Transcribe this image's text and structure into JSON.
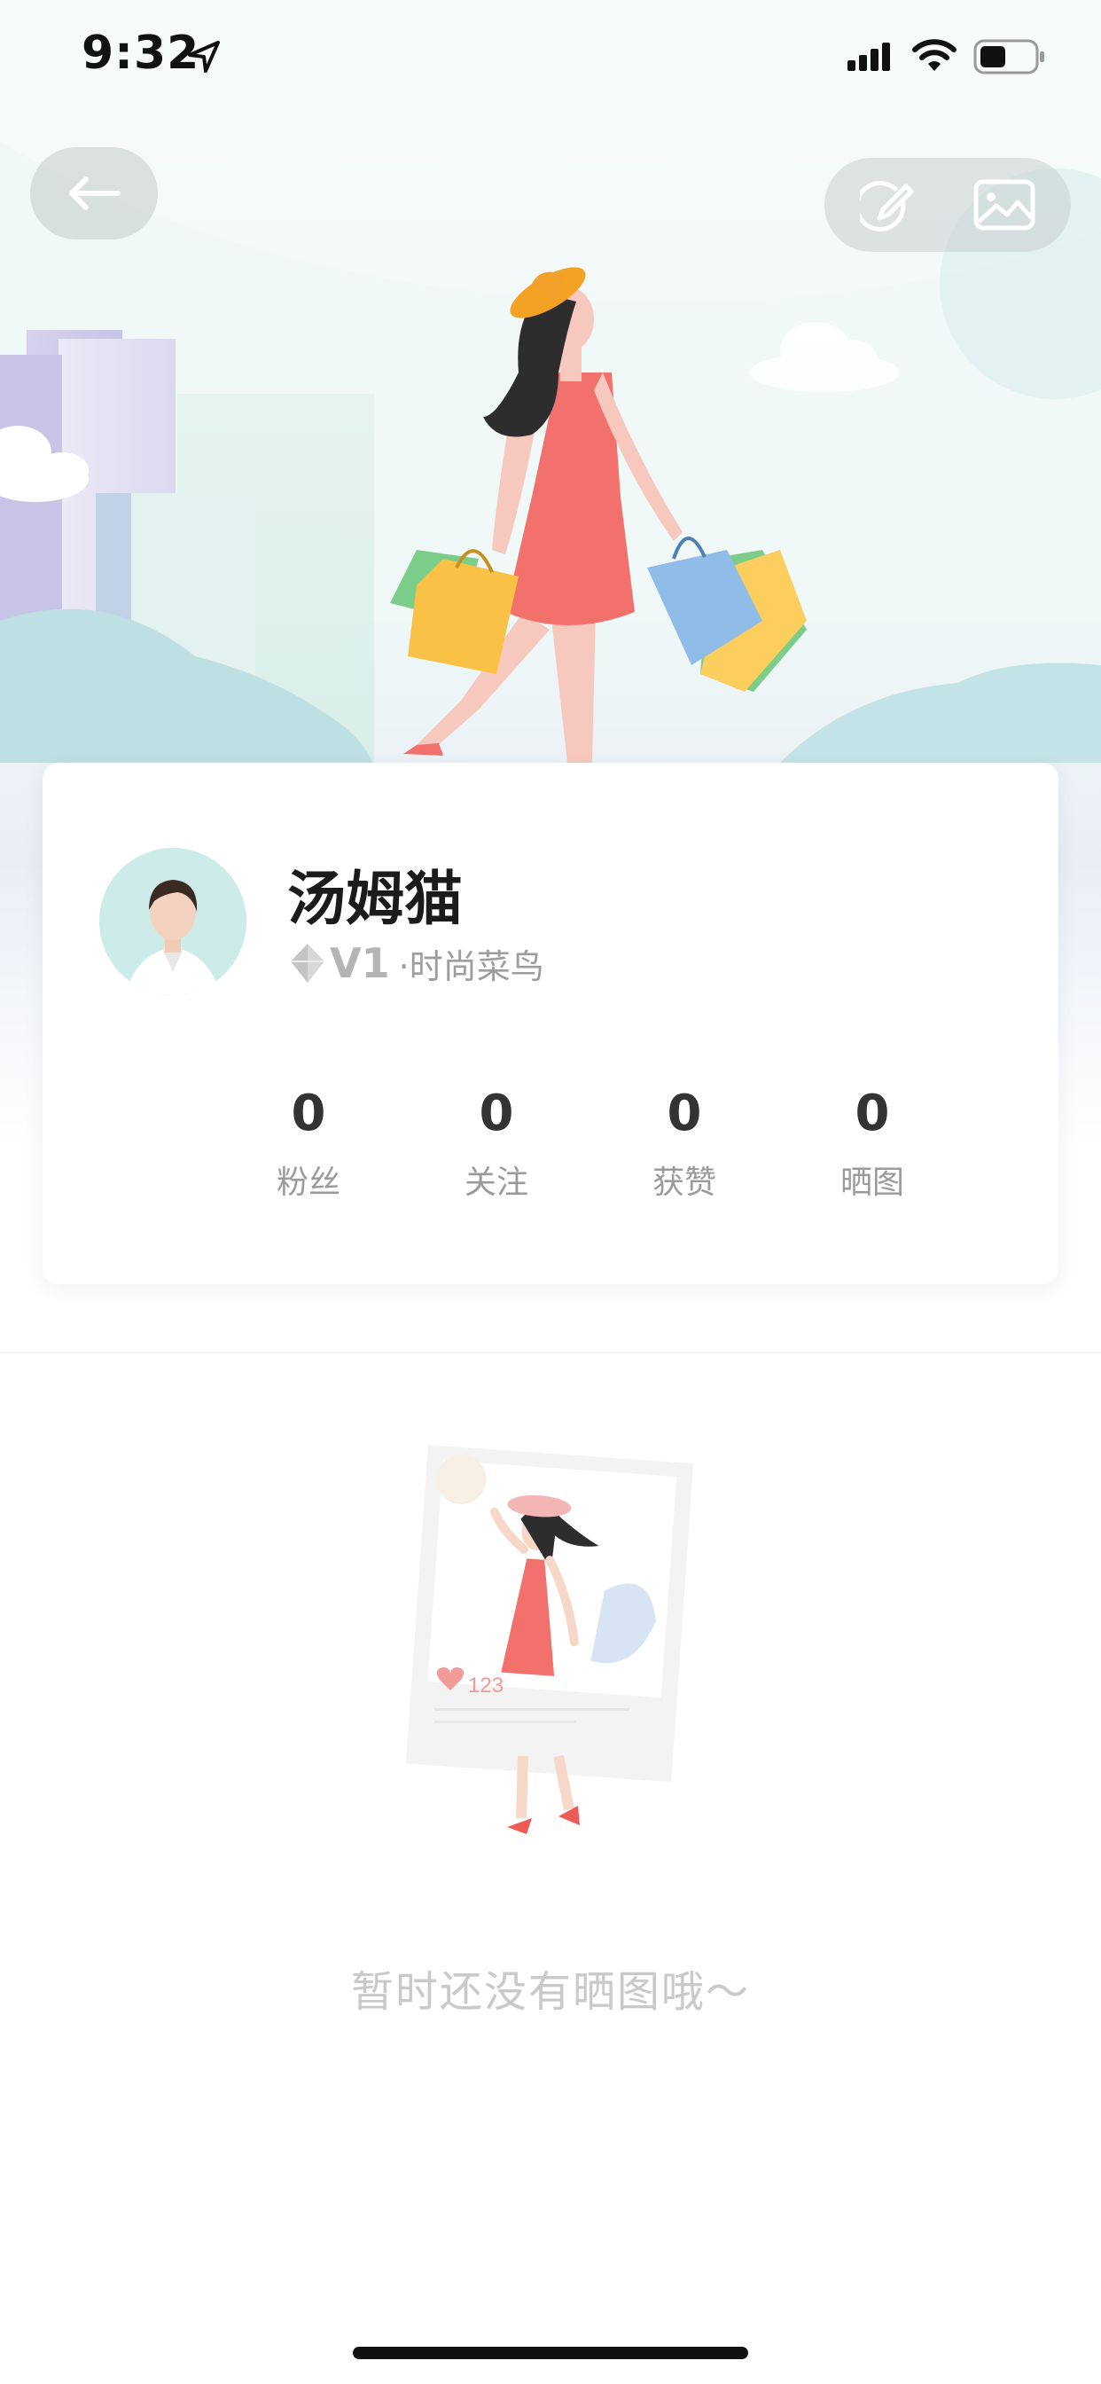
{
  "status_bar": {
    "time": "9:32",
    "icons": [
      "location-arrow-icon",
      "signal-icon",
      "wifi-icon",
      "battery-icon"
    ]
  },
  "header": {
    "back_icon": "arrow-left-icon",
    "edit_icon": "edit-icon",
    "photo_icon": "image-icon"
  },
  "profile": {
    "name": "汤姆猫",
    "level": "V1",
    "level_title": "·时尚菜鸟",
    "level_icon": "diamond-icon"
  },
  "stats": [
    {
      "value": "0",
      "label": "粉丝"
    },
    {
      "value": "0",
      "label": "关注"
    },
    {
      "value": "0",
      "label": "获赞"
    },
    {
      "value": "0",
      "label": "晒图"
    }
  ],
  "empty_state": {
    "card_likes": "123",
    "message": "暂时还没有晒图哦～"
  },
  "colors": {
    "hero_bg": "#eef8f8",
    "dress": "#f2716c",
    "text_dark": "#1b1b1b",
    "text_muted": "#9a9a9a"
  }
}
